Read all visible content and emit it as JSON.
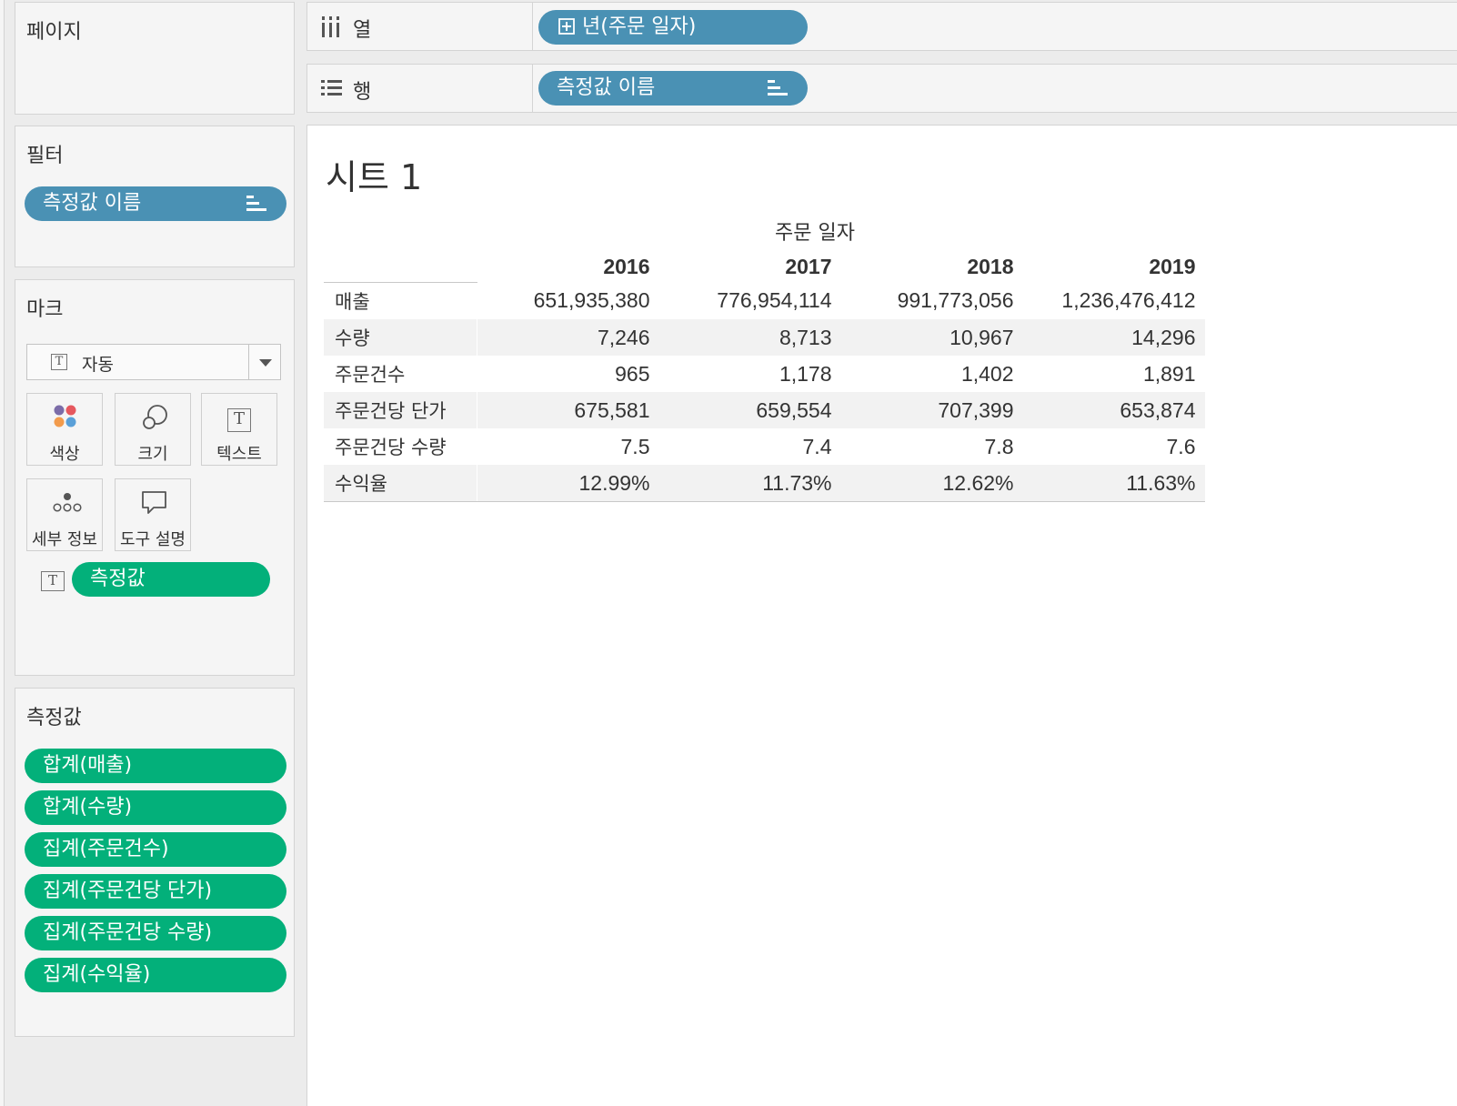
{
  "pages": {
    "title": "페이지"
  },
  "filters": {
    "title": "필터",
    "pill": "측정값 이름"
  },
  "marks": {
    "title": "마크",
    "type_select": "자동",
    "buttons": {
      "color": "색상",
      "size": "크기",
      "text": "텍스트",
      "detail": "세부 정보",
      "tooltip": "도구 설명"
    },
    "text_pill": "측정값"
  },
  "measure_values": {
    "title": "측정값",
    "pills": [
      "합계(매출)",
      "합계(수량)",
      "집계(주문건수)",
      "집계(주문건당 단가)",
      "집계(주문건당 수량)",
      "집계(수익율)"
    ]
  },
  "columns_shelf": {
    "label": "열",
    "pill": "년(주문 일자)"
  },
  "rows_shelf": {
    "label": "행",
    "pill": "측정값 이름"
  },
  "sheet": {
    "title": "시트 1",
    "column_header": "주문 일자",
    "years": [
      "2016",
      "2017",
      "2018",
      "2019"
    ],
    "rows": [
      {
        "label": "매출",
        "values": [
          "651,935,380",
          "776,954,114",
          "991,773,056",
          "1,236,476,412"
        ]
      },
      {
        "label": "수량",
        "values": [
          "7,246",
          "8,713",
          "10,967",
          "14,296"
        ]
      },
      {
        "label": "주문건수",
        "values": [
          "965",
          "1,178",
          "1,402",
          "1,891"
        ]
      },
      {
        "label": "주문건당 단가",
        "values": [
          "675,581",
          "659,554",
          "707,399",
          "653,874"
        ]
      },
      {
        "label": "주문건당 수량",
        "values": [
          "7.5",
          "7.4",
          "7.8",
          "7.6"
        ]
      },
      {
        "label": "수익율",
        "values": [
          "12.99%",
          "11.73%",
          "12.62%",
          "11.63%"
        ]
      }
    ]
  },
  "colors": {
    "blue_pill": "#4a91b4",
    "green_pill": "#03b07a"
  }
}
